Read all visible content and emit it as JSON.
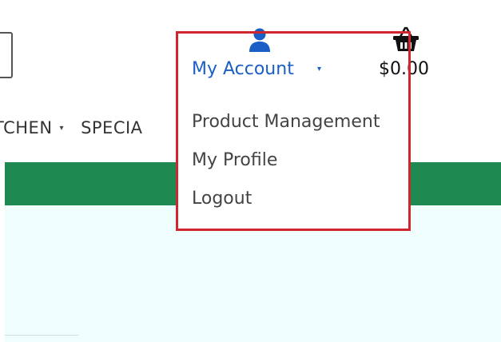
{
  "nav": {
    "items": [
      {
        "label": "TCHEN",
        "caret": "▾"
      },
      {
        "label": "SPECIA"
      }
    ]
  },
  "header": {
    "account": {
      "icon": "user-icon",
      "label": "My Account",
      "caret": "▾",
      "color": "#1a5fc6"
    },
    "cart": {
      "icon": "basket-icon",
      "total": "$0.00"
    }
  },
  "account_menu": {
    "items": [
      {
        "label": "Product Management"
      },
      {
        "label": "My Profile"
      },
      {
        "label": "Logout"
      }
    ]
  },
  "colors": {
    "green_band": "#1e8a52",
    "hero_bg": "#f0fdfd",
    "highlight": "#d0262d"
  }
}
